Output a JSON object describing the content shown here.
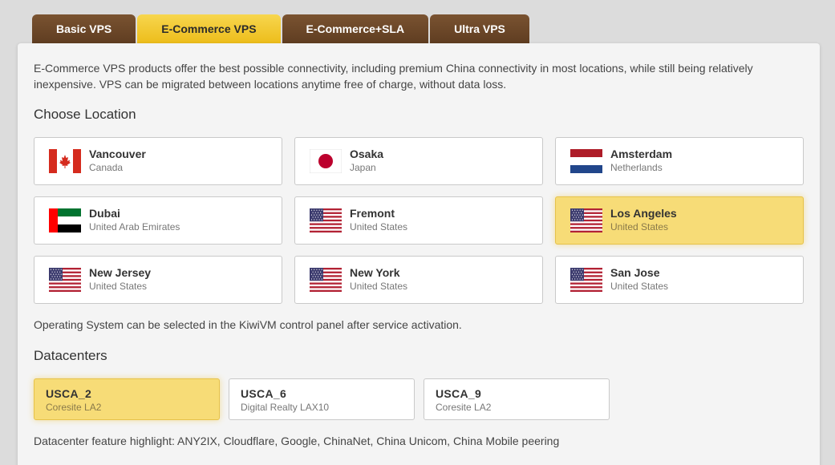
{
  "tabs": [
    {
      "label": "Basic VPS",
      "active": false
    },
    {
      "label": "E-Commerce VPS",
      "active": true
    },
    {
      "label": "E-Commerce+SLA",
      "active": false
    },
    {
      "label": "Ultra VPS",
      "active": false
    }
  ],
  "intro": "E-Commerce VPS products offer the best possible connectivity, including premium China connectivity in most locations, while still being relatively inexpensive. VPS can be migrated between locations anytime free of charge, without data loss.",
  "locations_title": "Choose Location",
  "locations": [
    {
      "city": "Vancouver",
      "country": "Canada",
      "flag": "canada-flag-icon",
      "selected": false
    },
    {
      "city": "Osaka",
      "country": "Japan",
      "flag": "japan-flag-icon",
      "selected": false
    },
    {
      "city": "Amsterdam",
      "country": "Netherlands",
      "flag": "netherlands-flag-icon",
      "selected": false
    },
    {
      "city": "Dubai",
      "country": "United Arab Emirates",
      "flag": "uae-flag-icon",
      "selected": false
    },
    {
      "city": "Fremont",
      "country": "United States",
      "flag": "us-flag-icon",
      "selected": false
    },
    {
      "city": "Los Angeles",
      "country": "United States",
      "flag": "us-flag-icon",
      "selected": true
    },
    {
      "city": "New Jersey",
      "country": "United States",
      "flag": "us-flag-icon",
      "selected": false
    },
    {
      "city": "New York",
      "country": "United States",
      "flag": "us-flag-icon",
      "selected": false
    },
    {
      "city": "San Jose",
      "country": "United States",
      "flag": "us-flag-icon",
      "selected": false
    }
  ],
  "os_note": "Operating System can be selected in the KiwiVM control panel after service activation.",
  "datacenters_title": "Datacenters",
  "datacenters": [
    {
      "code": "USCA_2",
      "name": "Coresite LA2",
      "selected": true
    },
    {
      "code": "USCA_6",
      "name": "Digital Realty LAX10",
      "selected": false
    },
    {
      "code": "USCA_9",
      "name": "Coresite LA2",
      "selected": false
    }
  ],
  "dc_highlight": "Datacenter feature highlight: ANY2IX, Cloudflare, Google, ChinaNet, China Unicom, China Mobile peering",
  "colors": {
    "tab_brown": "#6b4628",
    "tab_active": "#f2c833",
    "selected_card": "#f7dc77"
  }
}
